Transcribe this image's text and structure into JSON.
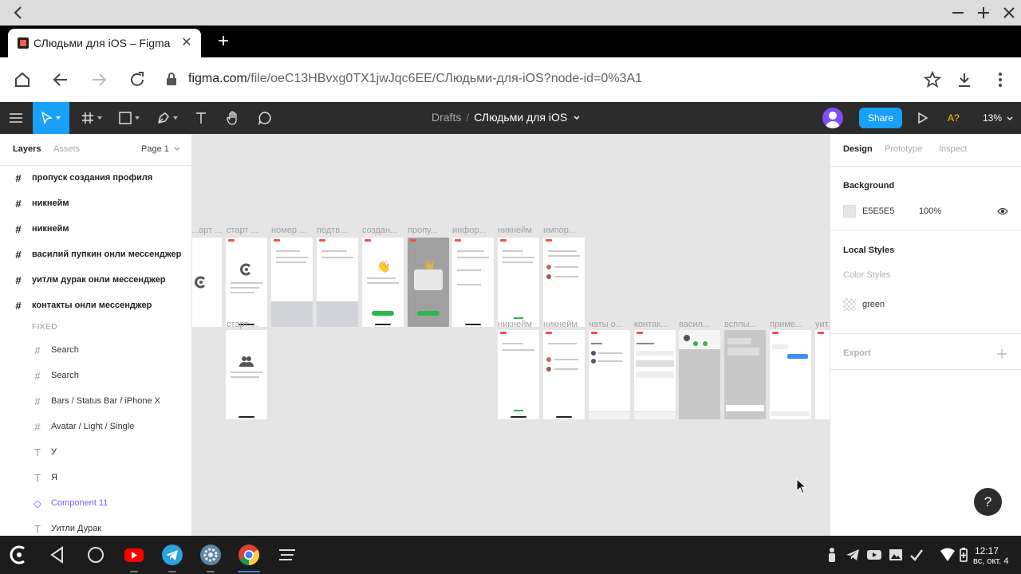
{
  "browser": {
    "tab_title": "СЛюдьми для iOS – Figma",
    "url_host": "figma.com",
    "url_path": "/file/oeC13HBvxg0TX1jwJqc6EE/СЛюдьми-для-iOS?node-id=0%3A1"
  },
  "figma": {
    "breadcrumb_drafts": "Drafts",
    "breadcrumb_sep": "/",
    "file_name": "СЛюдьми для iOS",
    "share_label": "Share",
    "a11y_label": "A?",
    "zoom_label": "13%"
  },
  "left_panel": {
    "tab_layers": "Layers",
    "tab_assets": "Assets",
    "page_label": "Page 1",
    "fixed_label": "FIXED",
    "top_layers": [
      {
        "label": "пропуск создания профиля",
        "icon": "frame-icon"
      },
      {
        "label": "никнейм",
        "icon": "frame-icon"
      },
      {
        "label": "никнейм",
        "icon": "frame-icon"
      },
      {
        "label": "василий пупкин онли мессенджер",
        "icon": "frame-icon"
      },
      {
        "label": "уитлм дурак онли мессенджер",
        "icon": "frame-icon"
      },
      {
        "label": "контакты онли мессенджер",
        "icon": "frame-icon"
      }
    ],
    "fixed_layers": [
      {
        "label": "Search",
        "icon": "frame-icon"
      },
      {
        "label": "Search",
        "icon": "frame-icon"
      },
      {
        "label": "Bars / Status Bar / iPhone X",
        "icon": "frame-icon"
      },
      {
        "label": "Avatar / Light / Single",
        "icon": "frame-icon"
      },
      {
        "label": "У",
        "icon": "text-icon"
      },
      {
        "label": "Я",
        "icon": "text-icon"
      },
      {
        "label": "Component 11",
        "icon": "component-icon"
      },
      {
        "label": "Уитли Дурак",
        "icon": "text-icon"
      }
    ]
  },
  "canvas": {
    "row1_labels": [
      "...арт ...",
      "старт ...",
      "номер ...",
      "подтв...",
      "создан...",
      "пропу...",
      "инфор...",
      "никнейм",
      "импор..."
    ],
    "row2_labels": [
      "старт ...",
      "никнейм",
      "никнейм",
      "чаты о...",
      "контак...",
      "васил...",
      "всплы...",
      "приме...",
      "уит..."
    ]
  },
  "right_panel": {
    "tab_design": "Design",
    "tab_prototype": "Prototype",
    "tab_inspect": "Inspect",
    "background_title": "Background",
    "background_hex": "E5E5E5",
    "background_opacity": "100%",
    "local_styles_title": "Local Styles",
    "color_styles_label": "Color Styles",
    "color_style_name": "green",
    "export_label": "Export",
    "help_label": "?"
  },
  "system": {
    "time": "12:17",
    "date": "вс, окт. 4"
  }
}
